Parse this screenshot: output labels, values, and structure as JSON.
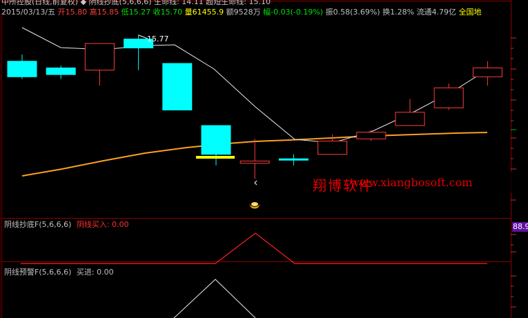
{
  "header": {
    "title": "中所控股(日线,前复权)  ◆ 阴线抄底(5,6,6,6)  生命线: 14.11  超短生命线: 15.10",
    "date": "2015/03/13/五",
    "open_label": "开",
    "open": "15.80",
    "high_label": "高",
    "high": "15.85",
    "low_label": "低",
    "low": "15.27",
    "close_label": "收",
    "close": "15.70",
    "volume_label": "量",
    "volume": "61455.9",
    "amount_label": "额",
    "amount": "9528万",
    "change_label": "幅",
    "change": "-0.03(-0.19%)",
    "amplitude_label": "振",
    "amplitude": "0.58(3.69%)",
    "turnover_label": "换",
    "turnover": "1.28%",
    "float_label": "流通",
    "float": "4.79亿",
    "region": "全国地"
  },
  "annotations": {
    "high_marker": "15.77"
  },
  "watermark": {
    "cn": "翔博软件",
    "url": "www.xiangbosoft.com"
  },
  "panel1": {
    "name": "阴线抄底F(5,6,6,6)",
    "series_label": "阴线买入: 0.00",
    "axis_value": "88.9"
  },
  "panel2": {
    "name": "阴线预警F(5,6,6,6)",
    "series_label": "买进: 0.00"
  },
  "colors": {
    "up": "#ff3c3c",
    "down": "#00ffff",
    "ma": "#ffa020",
    "line": "#ffffff",
    "signal1": "#ff2020",
    "grid": "#8b0000",
    "yellow": "#ffff00"
  },
  "chart_data": {
    "type": "candlestick",
    "candles": [
      {
        "dir": "down",
        "open": 15.7,
        "high": 16.0,
        "low": 14.9,
        "close": 15.0
      },
      {
        "dir": "down",
        "open": 15.4,
        "high": 15.5,
        "low": 14.9,
        "close": 15.1
      },
      {
        "dir": "up",
        "open": 15.3,
        "high": 16.5,
        "low": 14.6,
        "close": 16.5
      },
      {
        "dir": "down",
        "open": 16.7,
        "high": 16.9,
        "low": 15.3,
        "close": 16.3
      },
      {
        "dir": "down",
        "open": 15.6,
        "high": 15.6,
        "low": 13.5,
        "close": 13.5
      },
      {
        "dir": "down",
        "open": 12.8,
        "high": 12.8,
        "low": 11.0,
        "close": 11.5
      },
      {
        "dir": "up",
        "open": 11.1,
        "high": 12.2,
        "low": 10.4,
        "close": 11.2
      },
      {
        "dir": "down",
        "open": 11.3,
        "high": 11.5,
        "low": 11.0,
        "close": 11.3
      },
      {
        "dir": "up",
        "open": 11.5,
        "high": 12.4,
        "low": 11.5,
        "close": 12.1
      },
      {
        "dir": "up",
        "open": 12.2,
        "high": 12.6,
        "low": 12.1,
        "close": 12.5
      },
      {
        "dir": "up",
        "open": 12.8,
        "high": 14.0,
        "low": 12.8,
        "close": 13.4
      },
      {
        "dir": "up",
        "open": 13.6,
        "high": 14.7,
        "low": 13.5,
        "close": 14.5
      },
      {
        "dir": "up",
        "open": 15.0,
        "high": 15.7,
        "low": 14.6,
        "close": 15.4
      }
    ]
  }
}
